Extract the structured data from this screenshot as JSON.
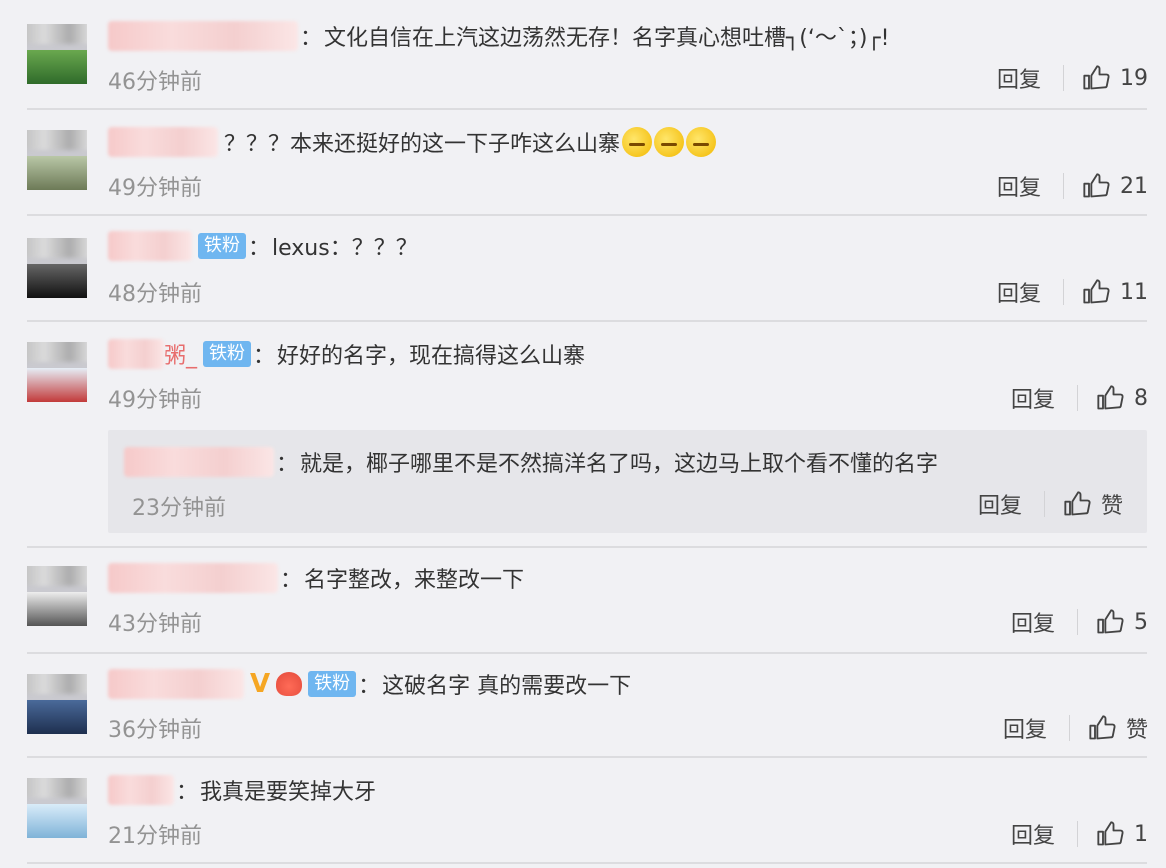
{
  "comments": [
    {
      "text": "文化自信在上汽这边荡然无存！名字真心想吐槽┐(‘～`；)┌!",
      "time": "46分钟前",
      "reply": "回复",
      "likes": "19"
    },
    {
      "text": "？？？本来还挺好的这一下子咋这么山寨",
      "time": "49分钟前",
      "reply": "回复",
      "likes": "21"
    },
    {
      "badge": "铁粉",
      "text": "lexus：？？？",
      "time": "48分钟前",
      "reply": "回复",
      "likes": "11"
    },
    {
      "name_suffix": "粥_",
      "badge": "铁粉",
      "text": "好好的名字，现在搞得这么山寨",
      "time": "49分钟前",
      "reply": "回复",
      "likes": "8"
    },
    {
      "text": "名字整改，来整改一下",
      "time": "43分钟前",
      "reply": "回复",
      "likes": "5"
    },
    {
      "vip": "V",
      "badge": "铁粉",
      "text": "这破名字 真的需要改一下",
      "time": "36分钟前",
      "reply": "回复",
      "likes": "赞"
    },
    {
      "text": "我真是要笑掉大牙",
      "time": "21分钟前",
      "reply": "回复",
      "likes": "1"
    }
  ],
  "subreply": {
    "text": "就是，椰子哪里不是不然搞洋名了吗，这边马上取个看不懂的名字",
    "time": "23分钟前",
    "reply": "回复",
    "likes": "赞"
  },
  "colon": "：",
  "icons": {
    "like": "thumbs-up-icon"
  }
}
